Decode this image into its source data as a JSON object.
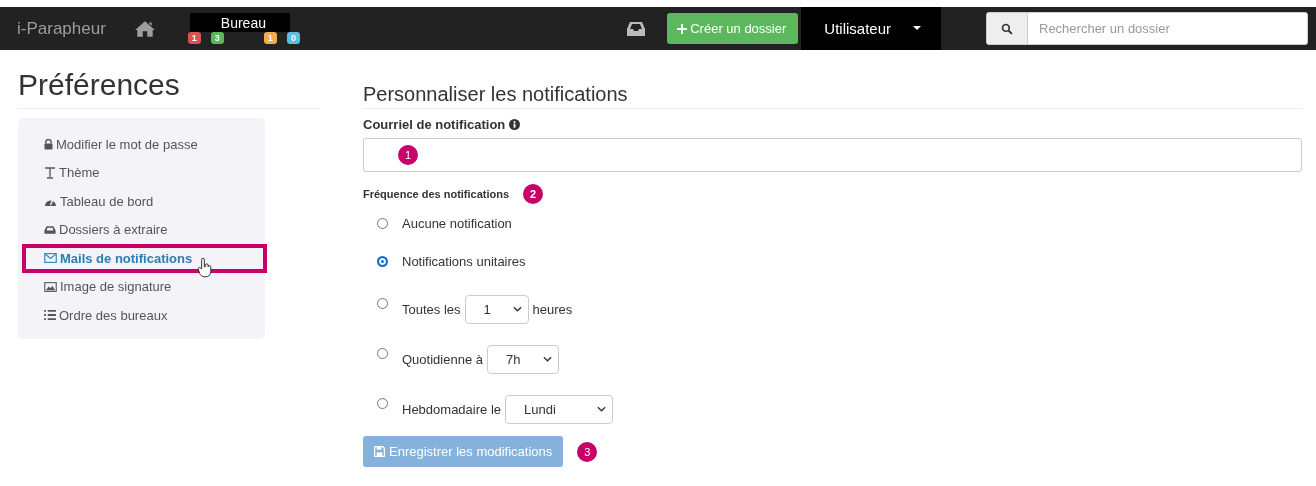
{
  "navbar": {
    "brand": "i-Parapheur",
    "desk": {
      "label": "Bureau",
      "badges": [
        {
          "count": "1",
          "color": "#d9534f"
        },
        {
          "count": "3",
          "color": "#5cb85c"
        },
        {
          "count": "1",
          "color": "#f0ad4e"
        },
        {
          "count": "0",
          "color": "#5bc0de"
        }
      ]
    },
    "create_button": "Créer un dossier",
    "user_menu": "Utilisateur",
    "search": {
      "placeholder": "Rechercher un dossier"
    }
  },
  "sidebar": {
    "title": "Préférences",
    "items": [
      {
        "label": "Modifier le mot de passe",
        "selected": false
      },
      {
        "label": "Thème",
        "selected": false
      },
      {
        "label": "Tableau de bord",
        "selected": false
      },
      {
        "label": "Dossiers à extraire",
        "selected": false
      },
      {
        "label": "Mails de notifications",
        "selected": true
      },
      {
        "label": "Image de signature",
        "selected": false
      },
      {
        "label": "Ordre des bureaux",
        "selected": false
      }
    ]
  },
  "main": {
    "title": "Personnaliser les notifications",
    "email": {
      "label": "Courriel de notification",
      "callout": "1"
    },
    "frequency": {
      "label": "Fréquence des notifications",
      "callout": "2",
      "options": [
        {
          "kind": "plain",
          "label": "Aucune notification",
          "selected": false
        },
        {
          "kind": "plain",
          "label": "Notifications unitaires",
          "selected": true
        },
        {
          "kind": "select",
          "prefix": "Toutes les",
          "value": "1",
          "suffix": "heures",
          "selected": false
        },
        {
          "kind": "select",
          "prefix": "Quotidienne à",
          "value": "7h",
          "selected": false
        },
        {
          "kind": "select",
          "prefix": "Hebdomadaire le",
          "value": "Lundi",
          "selected": false
        }
      ]
    },
    "save_button": {
      "label": "Enregistrer les modifications",
      "disabled": true,
      "callout": "3"
    }
  }
}
